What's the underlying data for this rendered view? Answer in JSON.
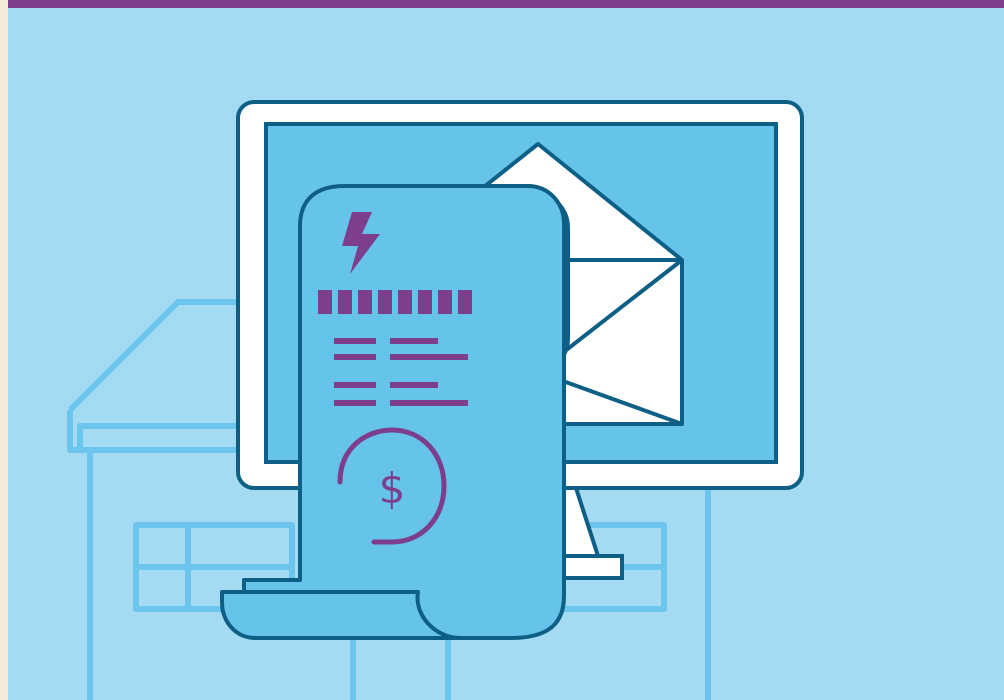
{
  "illustration": {
    "theme": "electronic billing / paperless statement",
    "colors": {
      "background": "#a4dbf2",
      "top_bar": "#7d3f8c",
      "house_outline": "#6cc5ec",
      "monitor_frame": "#ffffff",
      "screen": "#66c3ea",
      "outline": "#0d5f85",
      "envelope": "#ffffff",
      "receipt": "#66c3ea",
      "accent_purple": "#7d3f8c",
      "accent_green": "#bac138"
    },
    "receipt": {
      "currency_symbol": "$",
      "icon": "lightning-bolt-icon"
    },
    "icons": [
      "house-outline-icon",
      "monitor-icon",
      "envelope-icon",
      "receipt-icon",
      "lightning-bolt-icon",
      "dollar-coin-icon"
    ]
  }
}
